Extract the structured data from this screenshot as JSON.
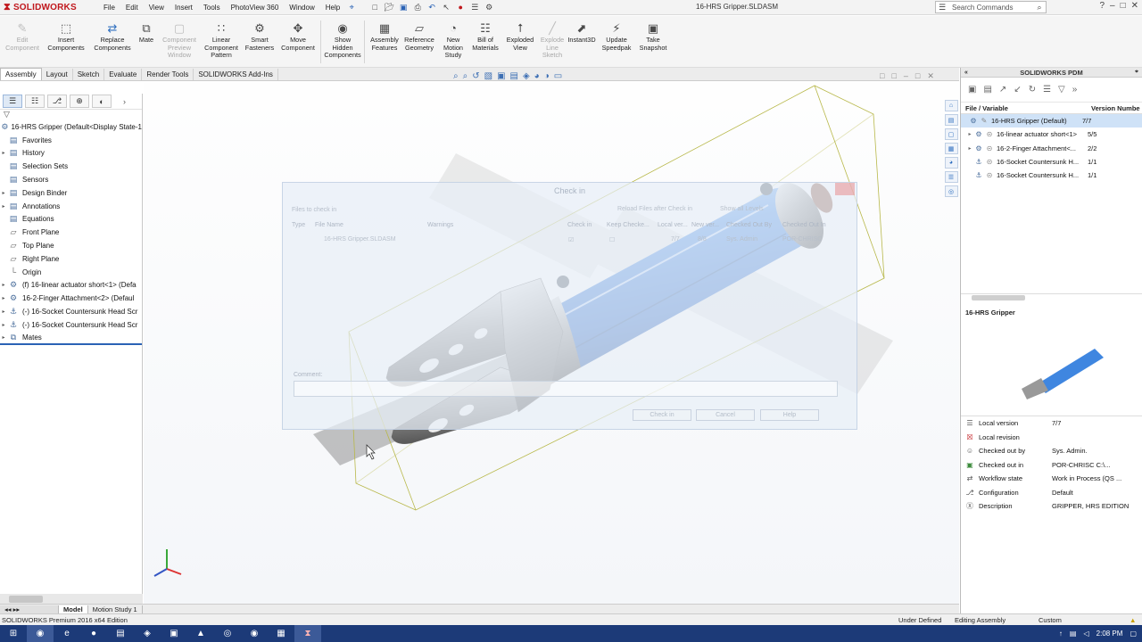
{
  "app": {
    "logo_text": "SOLIDWORKS",
    "doc_title": "16-HRS Gripper.SLDASM",
    "menu": [
      "File",
      "Edit",
      "View",
      "Insert",
      "Tools",
      "PhotoView 360",
      "Window",
      "Help"
    ],
    "search_placeholder": "Search Commands",
    "icons": {
      "pin": "pin-icon",
      "search": "search-icon",
      "help": "help-icon"
    }
  },
  "commands": [
    {
      "label": "Edit Component",
      "disabled": true,
      "icon": "edit-component-icon"
    },
    {
      "label": "Insert Components",
      "disabled": false,
      "icon": "insert-components-icon"
    },
    {
      "label": "Replace Components",
      "disabled": false,
      "icon": "replace-components-icon"
    },
    {
      "label": "Mate",
      "disabled": false,
      "icon": "mate-icon"
    },
    {
      "label": "Component Preview Window",
      "disabled": true,
      "icon": "preview-window-icon"
    },
    {
      "label": "Linear Component Pattern",
      "disabled": false,
      "icon": "linear-pattern-icon"
    },
    {
      "label": "Smart Fasteners",
      "disabled": false,
      "icon": "smart-fasteners-icon"
    },
    {
      "label": "Move Component",
      "disabled": false,
      "icon": "move-component-icon"
    },
    {
      "label": "Show Hidden Components",
      "disabled": false,
      "icon": "show-hidden-icon"
    },
    {
      "label": "Assembly Features",
      "disabled": false,
      "icon": "assembly-features-icon"
    },
    {
      "label": "Reference Geometry",
      "disabled": false,
      "icon": "reference-geometry-icon"
    },
    {
      "label": "New Motion Study",
      "disabled": false,
      "icon": "motion-study-icon"
    },
    {
      "label": "Bill of Materials",
      "disabled": false,
      "icon": "bom-icon"
    },
    {
      "label": "Exploded View",
      "disabled": false,
      "icon": "exploded-view-icon"
    },
    {
      "label": "Explode Line Sketch",
      "disabled": true,
      "icon": "explode-line-icon"
    },
    {
      "label": "Instant3D",
      "disabled": false,
      "icon": "instant3d-icon"
    },
    {
      "label": "Update Speedpak",
      "disabled": false,
      "icon": "speedpak-icon"
    },
    {
      "label": "Take Snapshot",
      "disabled": false,
      "icon": "snapshot-icon"
    }
  ],
  "tabs": [
    "Assembly",
    "Layout",
    "Sketch",
    "Evaluate",
    "Render Tools",
    "SOLIDWORKS Add-Ins"
  ],
  "active_tab": "Assembly",
  "feature_tree": [
    {
      "label": "16-HRS Gripper  (Default<Display State-1",
      "expandable": false,
      "icon": "assembly-icon"
    },
    {
      "label": "Favorites",
      "expandable": false,
      "icon": "favorites-icon"
    },
    {
      "label": "History",
      "expandable": true,
      "icon": "history-icon"
    },
    {
      "label": "Selection Sets",
      "expandable": false,
      "icon": "selection-sets-icon"
    },
    {
      "label": "Sensors",
      "expandable": false,
      "icon": "sensors-icon"
    },
    {
      "label": "Design Binder",
      "expandable": true,
      "icon": "design-binder-icon"
    },
    {
      "label": "Annotations",
      "expandable": true,
      "icon": "annotations-icon"
    },
    {
      "label": "Equations",
      "expandable": false,
      "icon": "equations-icon"
    },
    {
      "label": "Front Plane",
      "expandable": false,
      "icon": "plane-icon"
    },
    {
      "label": "Top Plane",
      "expandable": false,
      "icon": "plane-icon"
    },
    {
      "label": "Right Plane",
      "expandable": false,
      "icon": "plane-icon"
    },
    {
      "label": "Origin",
      "expandable": false,
      "icon": "origin-icon"
    },
    {
      "label": "(f) 16-linear actuator short<1> (Defa",
      "expandable": true,
      "icon": "subassembly-icon"
    },
    {
      "label": "16-2-Finger Attachment<2> (Defaul",
      "expandable": true,
      "icon": "subassembly-icon"
    },
    {
      "label": "(-) 16-Socket Countersunk Head Scr",
      "expandable": true,
      "icon": "part-icon"
    },
    {
      "label": "(-) 16-Socket Countersunk Head Scr",
      "expandable": true,
      "icon": "part-icon"
    },
    {
      "label": "Mates",
      "expandable": true,
      "icon": "mates-icon"
    }
  ],
  "model_tabs": [
    "Model",
    "Motion Study 1"
  ],
  "active_model_tab": "Model",
  "dialog": {
    "title": "Check in",
    "subtitle": "Files to check in",
    "option_reload": "Reload Files after Check in",
    "option_levels": "Show all Levels",
    "columns": [
      "Type",
      "File Name",
      "Warnings",
      "Check in",
      "Keep Checke...",
      "Local ver...",
      "New ver...",
      "Checked Out By",
      "Checked Out In"
    ],
    "rows": [
      {
        "name": "16-HRS Gripper.SLDASM",
        "local": "7/7",
        "new": "8/8",
        "by": "Sys. Admin",
        "in": "POR-CHRISC"
      }
    ],
    "comment_label": "Comment:",
    "buttons": [
      "Check in",
      "Cancel",
      "Help"
    ]
  },
  "pdm": {
    "title": "SOLIDWORKS PDM",
    "col_file": "File / Variable",
    "col_version": "Version Numbe",
    "files": [
      {
        "name": "16-HRS Gripper  (Default)",
        "version": "7/7",
        "selected": true,
        "expandable": false,
        "icon": "assembly-icon"
      },
      {
        "name": "16-linear actuator short<1>",
        "version": "5/5",
        "selected": false,
        "expandable": true,
        "icon": "subassembly-icon"
      },
      {
        "name": "16-2-Finger Attachment<...",
        "version": "2/2",
        "selected": false,
        "expandable": true,
        "icon": "subassembly-icon"
      },
      {
        "name": "16-Socket Countersunk H...",
        "version": "1/1",
        "selected": false,
        "expandable": false,
        "icon": "part-icon"
      },
      {
        "name": "16-Socket Countersunk H...",
        "version": "1/1",
        "selected": false,
        "expandable": false,
        "icon": "part-icon"
      }
    ],
    "preview_title": "16-HRS Gripper",
    "properties": [
      {
        "key": "Local version",
        "value": "7/7",
        "icon": "version-icon"
      },
      {
        "key": "Local revision",
        "value": "",
        "icon": "revision-icon"
      },
      {
        "key": "Checked out by",
        "value": "Sys. Admin.",
        "icon": "user-icon"
      },
      {
        "key": "Checked out in",
        "value": "POR-CHRISC  C:\\...",
        "icon": "computer-icon"
      },
      {
        "key": "Workflow state",
        "value": "Work in Process (QS ...",
        "icon": "workflow-icon"
      },
      {
        "key": "Configuration",
        "value": "Default",
        "icon": "configuration-icon"
      },
      {
        "key": "Description",
        "value": "GRIPPER, HRS EDITION",
        "icon": "description-icon"
      }
    ]
  },
  "status": {
    "edition": "SOLIDWORKS Premium 2016 x64 Edition",
    "defined": "Under Defined",
    "mode": "Editing Assembly",
    "units": "Custom"
  },
  "clock": "2:08 PM",
  "colors": {
    "accent": "#c0171c",
    "selection": "#cfe2f7",
    "taskbar": "#1c3a78",
    "actuator_blue": "#3f86e0"
  }
}
